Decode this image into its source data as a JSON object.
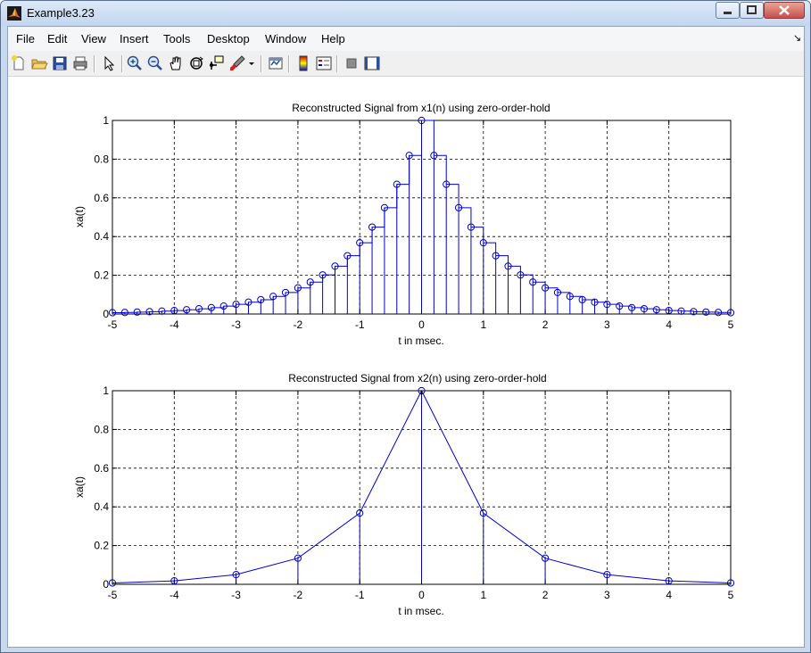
{
  "window": {
    "title": "Example3.23"
  },
  "menu": {
    "items": [
      "File",
      "Edit",
      "View",
      "Insert",
      "Tools",
      "Desktop",
      "Window",
      "Help"
    ],
    "dock_arrow": "↘"
  },
  "toolbar": {
    "icons": [
      "new-figure-icon",
      "open-file-icon",
      "save-icon",
      "print-icon",
      "select-arrow-icon",
      "zoom-in-icon",
      "zoom-out-icon",
      "pan-hand-icon",
      "rotate-3d-icon",
      "data-cursor-icon",
      "brush-icon",
      "brush-dropdown-icon",
      "link-plot-icon",
      "colorbar-icon",
      "legend-icon",
      "hide-plot-tools-icon",
      "show-plot-tools-icon"
    ]
  },
  "colors": {
    "line": "#0000cc",
    "marker": "#0000cc",
    "grid": "#000000"
  },
  "chart_data": [
    {
      "type": "line",
      "style": "zero-order-hold stairs with stems and circle markers",
      "title": "Reconstructed Signal from x1(n) using zero-order-hold",
      "xlabel": "t in msec.",
      "ylabel": "xa(t)",
      "xlim": [
        -5,
        5
      ],
      "ylim": [
        0,
        1
      ],
      "xticks": [
        "-5",
        "-4",
        "-3",
        "-2",
        "-1",
        "0",
        "1",
        "2",
        "3",
        "4",
        "5"
      ],
      "yticks": [
        "0",
        "0.2",
        "0.4",
        "0.6",
        "0.8",
        "1"
      ],
      "grid": true,
      "sample_period": 0.2,
      "x": [
        -5,
        -4.8,
        -4.6,
        -4.4,
        -4.2,
        -4,
        -3.8,
        -3.6,
        -3.4,
        -3.2,
        -3,
        -2.8,
        -2.6,
        -2.4,
        -2.2,
        -2,
        -1.8,
        -1.6,
        -1.4,
        -1.2,
        -1,
        -0.8,
        -0.6,
        -0.4,
        -0.2,
        0,
        0.2,
        0.4,
        0.6,
        0.8,
        1,
        1.2,
        1.4,
        1.6,
        1.8,
        2,
        2.2,
        2.4,
        2.6,
        2.8,
        3,
        3.2,
        3.4,
        3.6,
        3.8,
        4,
        4.2,
        4.4,
        4.6,
        4.8,
        5
      ],
      "y": [
        0.007,
        0.008,
        0.01,
        0.012,
        0.015,
        0.018,
        0.022,
        0.027,
        0.033,
        0.041,
        0.05,
        0.061,
        0.074,
        0.091,
        0.111,
        0.135,
        0.165,
        0.202,
        0.247,
        0.301,
        0.368,
        0.449,
        0.549,
        0.67,
        0.819,
        1.0,
        0.819,
        0.67,
        0.549,
        0.449,
        0.368,
        0.301,
        0.247,
        0.202,
        0.165,
        0.135,
        0.111,
        0.091,
        0.074,
        0.061,
        0.05,
        0.041,
        0.033,
        0.027,
        0.022,
        0.018,
        0.015,
        0.012,
        0.01,
        0.008,
        0.007
      ]
    },
    {
      "type": "line",
      "style": "zero-order-hold samples connected, with stems and circle markers",
      "title": "Reconstructed Signal from x2(n) using zero-order-hold",
      "xlabel": "t in msec.",
      "ylabel": "xa(t)",
      "xlim": [
        -5,
        5
      ],
      "ylim": [
        0,
        1
      ],
      "xticks": [
        "-5",
        "-4",
        "-3",
        "-2",
        "-1",
        "0",
        "1",
        "2",
        "3",
        "4",
        "5"
      ],
      "yticks": [
        "0",
        "0.2",
        "0.4",
        "0.6",
        "0.8",
        "1"
      ],
      "grid": true,
      "sample_period": 1,
      "x": [
        -5,
        -4,
        -3,
        -2,
        -1,
        0,
        1,
        2,
        3,
        4,
        5
      ],
      "y": [
        0.007,
        0.018,
        0.05,
        0.135,
        0.368,
        1.0,
        0.368,
        0.135,
        0.05,
        0.018,
        0.007
      ]
    }
  ]
}
